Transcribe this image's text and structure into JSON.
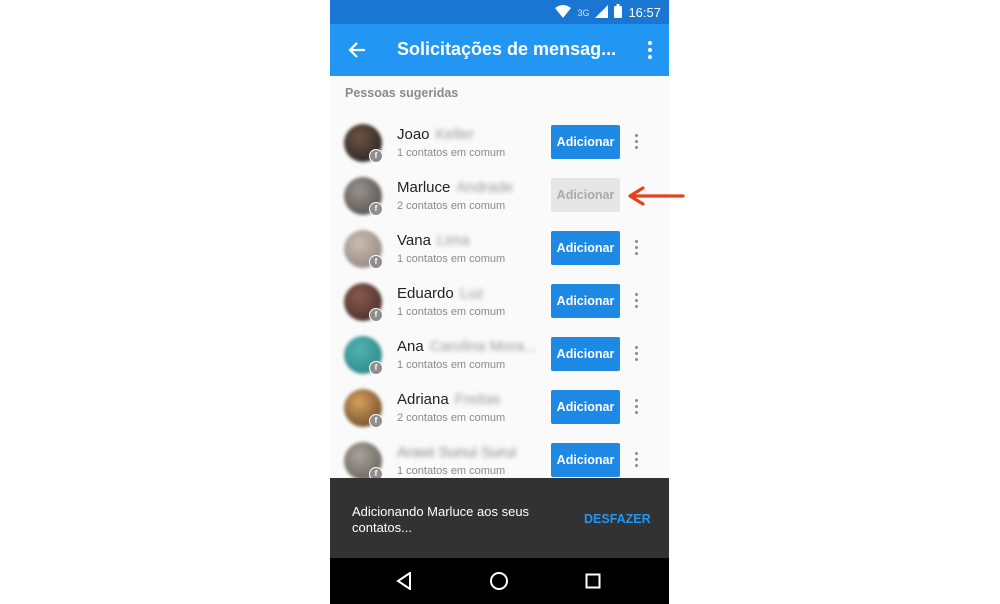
{
  "status": {
    "network": "3G",
    "time": "16:57"
  },
  "appbar": {
    "title": "Solicitações de mensag..."
  },
  "section": {
    "title": "Pessoas sugeridas"
  },
  "people": [
    {
      "first": "Joao",
      "last": "Keller",
      "mutual": "1 contatos em comum",
      "button": "Adicionar",
      "added": false,
      "avatar": [
        "#6d5446",
        "#1e1a18"
      ]
    },
    {
      "first": "Marluce",
      "last": "Andrade",
      "mutual": "2 contatos em comum",
      "button": "Adicionar",
      "added": true,
      "avatar": [
        "#98928c",
        "#4a4644"
      ]
    },
    {
      "first": "Vana",
      "last": "Lima",
      "mutual": "1 contatos em comum",
      "button": "Adicionar",
      "added": false,
      "avatar": [
        "#c9bdb4",
        "#8a7c74"
      ]
    },
    {
      "first": "Eduardo",
      "last": "Luz",
      "mutual": "1 contatos em comum",
      "button": "Adicionar",
      "added": false,
      "avatar": [
        "#8a5a4e",
        "#3b2622"
      ]
    },
    {
      "first": "Ana",
      "last": "Carolina Mora...",
      "mutual": "1 contatos em comum",
      "button": "Adicionar",
      "added": false,
      "avatar": [
        "#4fb3b0",
        "#2b7f80"
      ]
    },
    {
      "first": "Adriana",
      "last": "Freitas",
      "mutual": "2 contatos em comum",
      "button": "Adicionar",
      "added": false,
      "avatar": [
        "#d6a15c",
        "#5a3b22"
      ]
    },
    {
      "first": "",
      "last": "Arawi Sunui Surui",
      "mutual": "1 contatos em comum",
      "button": "Adicionar",
      "added": false,
      "avatar": [
        "#a8a29a",
        "#5c5650"
      ]
    }
  ],
  "snackbar": {
    "message": "Adicionando Marluce aos seus contatos...",
    "action": "DESFAZER"
  },
  "colors": {
    "statusbar": "#1976d2",
    "appbar": "#2196f3",
    "button": "#1e88e5",
    "annotation": "#e8401c"
  }
}
